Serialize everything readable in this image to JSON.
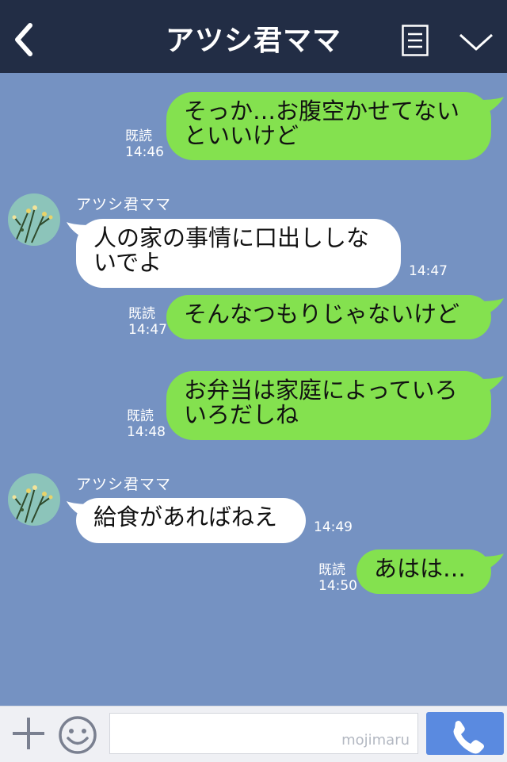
{
  "header": {
    "title": "アツシ君ママ"
  },
  "messages": [
    {
      "side": "me",
      "lines": [
        "そっか…お腹空かせてない",
        "といいけど"
      ],
      "read": "既読",
      "time": "14:46"
    },
    {
      "side": "them",
      "sender": "アツシ君ママ",
      "lines": [
        "人の家の事情に口出ししな",
        "いでよ"
      ],
      "time": "14:47"
    },
    {
      "side": "me",
      "lines": [
        "そんなつもりじゃないけど"
      ],
      "read": "既読",
      "time": "14:47"
    },
    {
      "side": "me",
      "lines": [
        "お弁当は家庭によっていろ",
        "いろだしね"
      ],
      "read": "既読",
      "time": "14:48"
    },
    {
      "side": "them",
      "sender": "アツシ君ママ",
      "lines": [
        "給食があればねえ"
      ],
      "time": "14:49"
    },
    {
      "side": "me",
      "lines": [
        "あはは…"
      ],
      "read": "既読",
      "time": "14:50"
    }
  ],
  "input": {
    "placeholder": "",
    "watermark": "mojimaru"
  },
  "colors": {
    "header_bg": "#222d45",
    "chat_bg": "#7592c2",
    "my_bubble": "#84e14f",
    "their_bubble": "#ffffff",
    "call_button": "#5a8ae0"
  },
  "icons": {
    "back": "chevron-left-icon",
    "menu": "menu-icon",
    "collapse": "chevron-down-icon",
    "add": "plus-icon",
    "sticker": "smiley-icon",
    "call": "phone-icon"
  }
}
